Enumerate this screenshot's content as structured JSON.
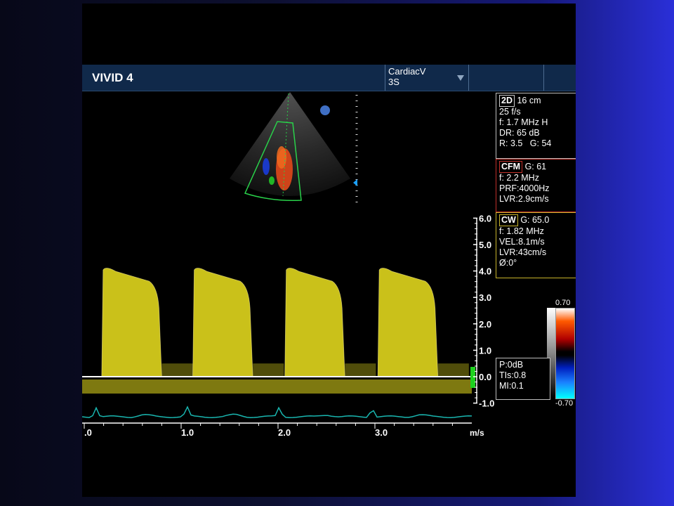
{
  "header": {
    "app_title": "VIVID 4",
    "preset": "CardiacV",
    "probe": "3S"
  },
  "panels": {
    "mode_2d": {
      "label": "2D",
      "depth": "16 cm",
      "frame_rate": "25 f/s",
      "frequency": "f: 1.7 MHz H",
      "dynamic_range": "DR: 65 dB",
      "r_value": "R: 3.5",
      "gain": "G: 54"
    },
    "mode_cfm": {
      "label": "CFM",
      "gain": "G: 61",
      "frequency": "f: 2.2 MHz",
      "prf": "PRF:4000Hz",
      "lvr": "LVR:2.9cm/s"
    },
    "mode_cw": {
      "label": "CW",
      "gain": "G: 65.0",
      "frequency": "f: 1.82 MHz",
      "velocity": "VEL:8.1m/s",
      "lvr": "LVR:43cm/s",
      "angle": "Ø:0°"
    },
    "output": {
      "power": "P:0dB",
      "tis": "TIs:0.8",
      "mi": "MI:0.1"
    }
  },
  "color_scale": {
    "max_label": "0.70",
    "min_label": "-0.70"
  },
  "doppler": {
    "velocity_unit": "m/s",
    "velocity_ticks": [
      "6.0",
      "5.0",
      "4.0",
      "3.0",
      "2.0",
      "1.0",
      "0.0",
      "-1.0"
    ],
    "velocity_values": [
      6,
      5,
      4,
      3,
      2,
      1,
      0,
      -1
    ],
    "time_ticks": [
      ".0",
      "1.0",
      "2.0",
      "3.0"
    ],
    "time_values": [
      0,
      1,
      2,
      3
    ],
    "jet_peak_velocity": 4.2,
    "jet_start_times": [
      0.18,
      1.12,
      2.07,
      3.03
    ],
    "jet_duration": 0.62,
    "colors": {
      "spectrum": "#e6dc1e",
      "ecg": "#19b6b0",
      "baseline": "#ffffff",
      "marker": "#1ed21e"
    }
  }
}
